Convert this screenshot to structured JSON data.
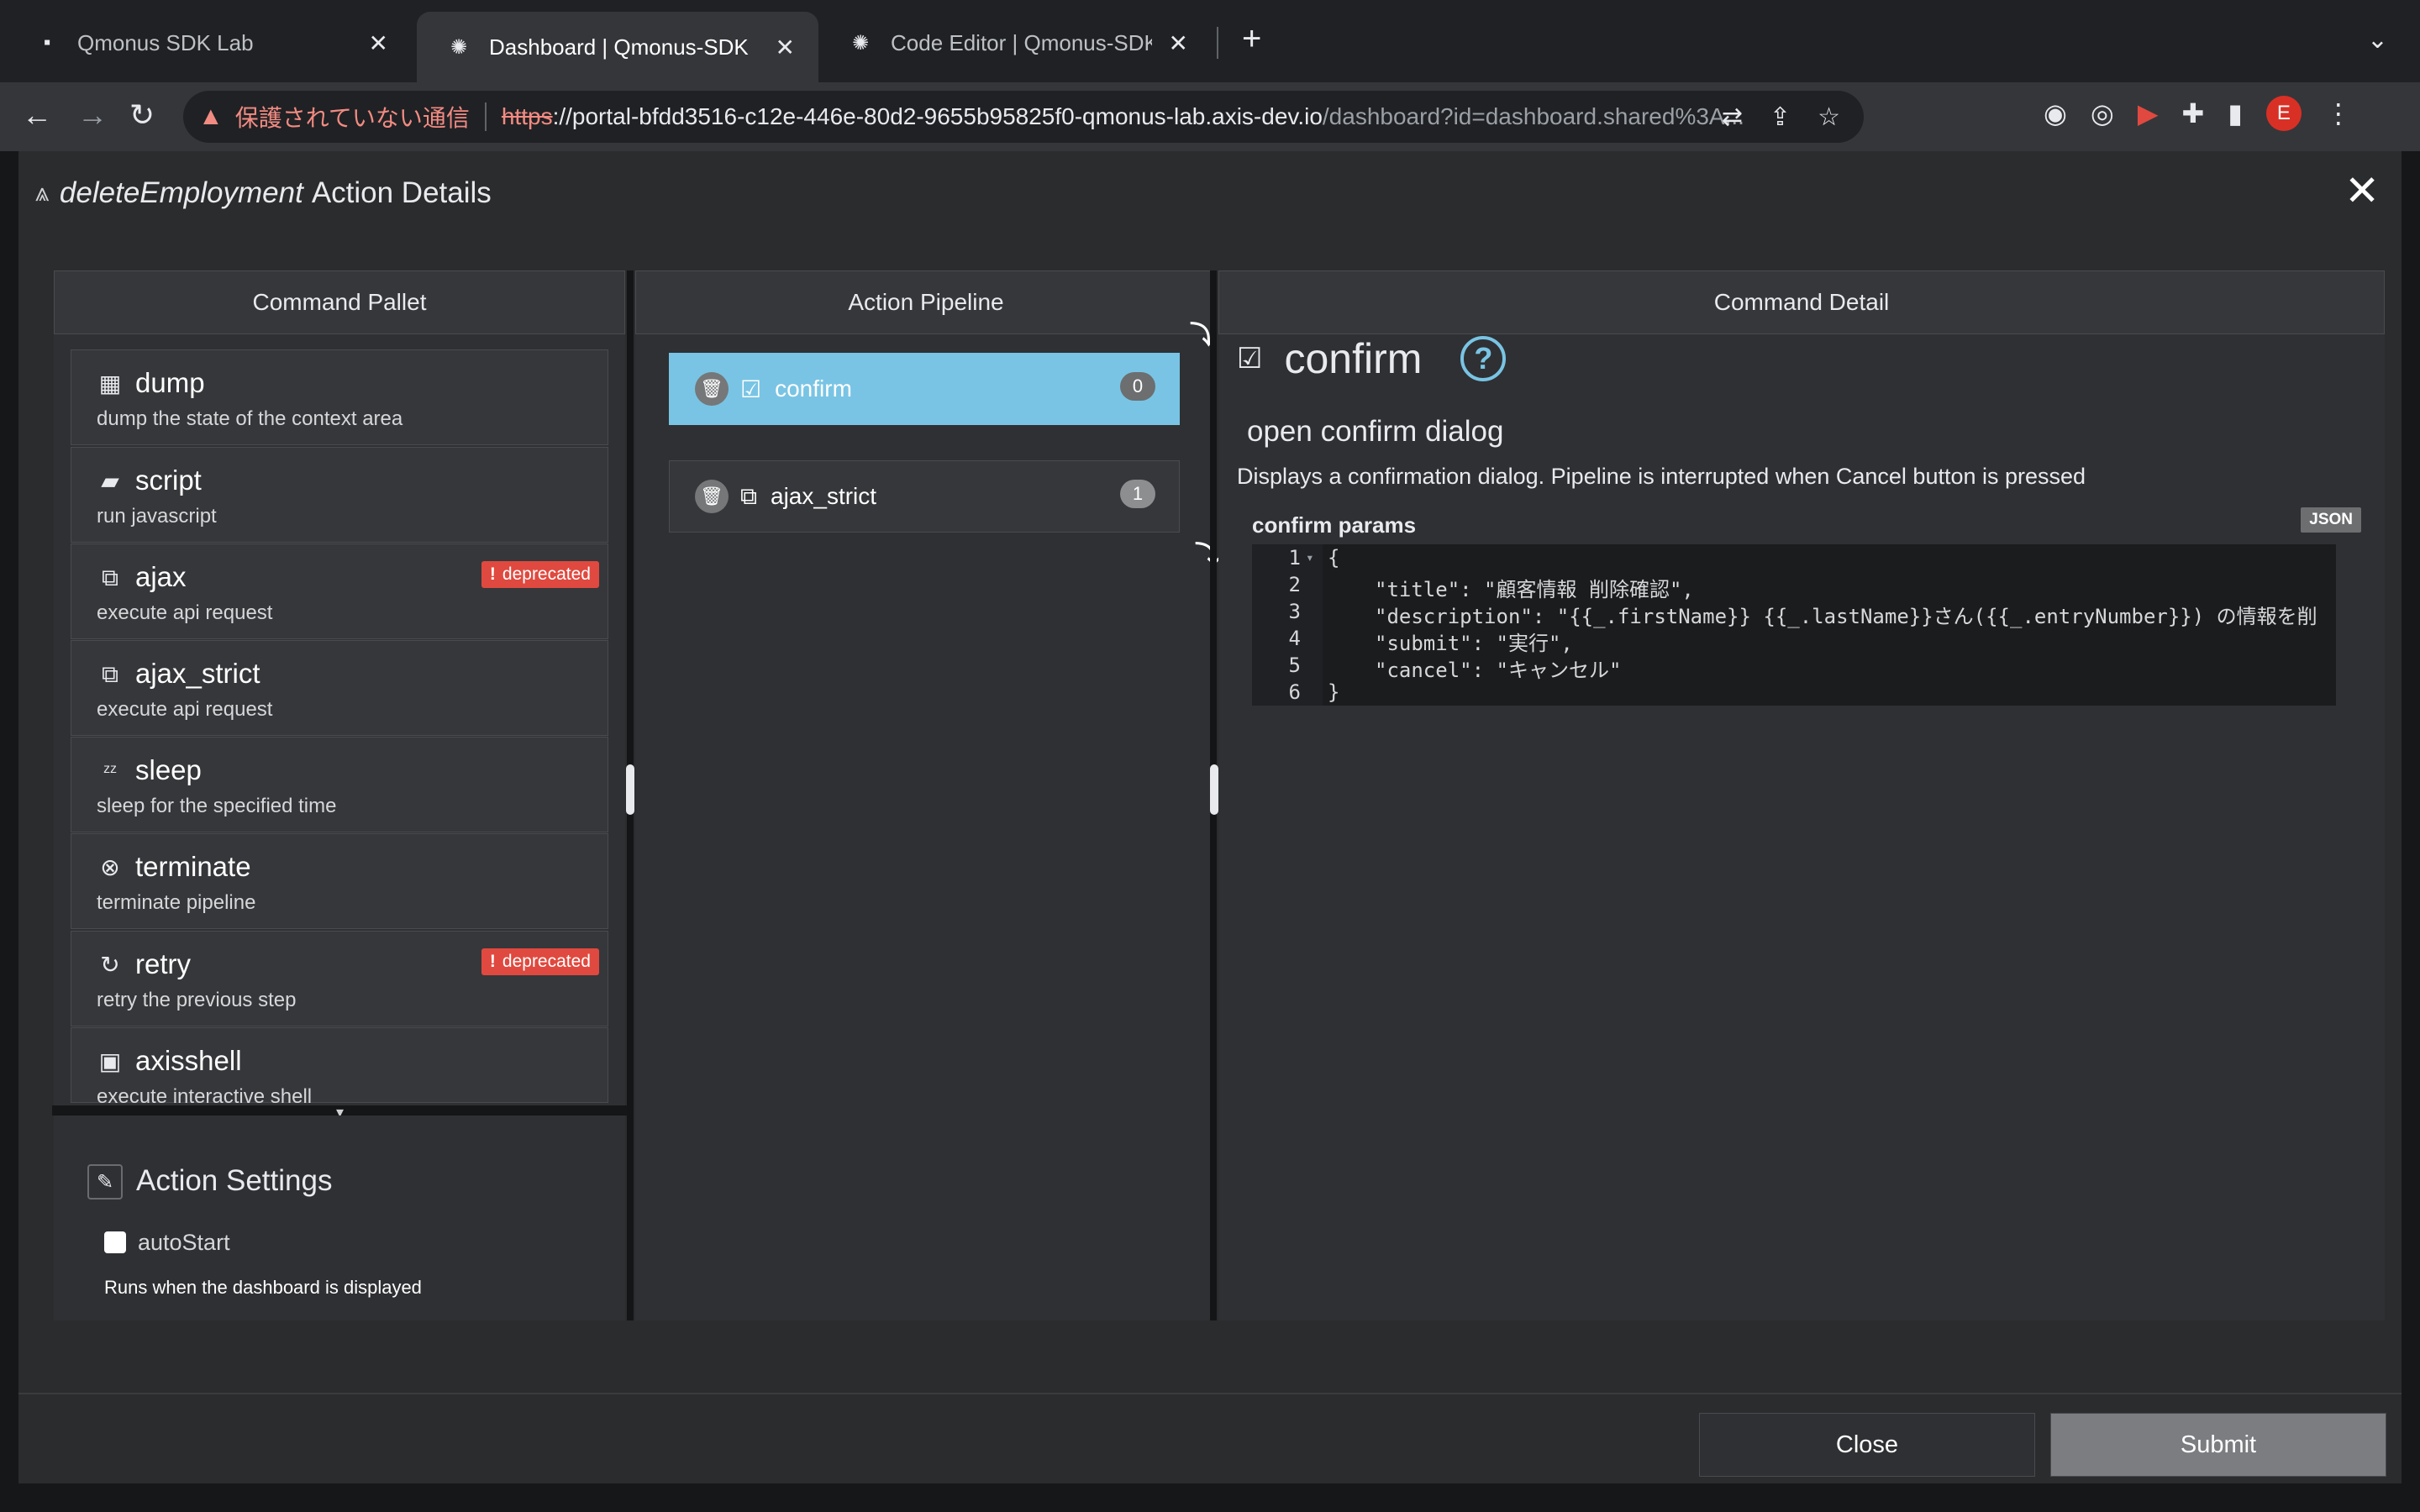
{
  "browser": {
    "tabs": [
      {
        "title": "Qmonus SDK Lab",
        "active": false
      },
      {
        "title": "Dashboard | Qmonus-SDK",
        "active": true
      },
      {
        "title": "Code Editor | Qmonus-SDK",
        "active": false
      }
    ],
    "address": {
      "security_text": "保護されていない通信",
      "scheme": "https",
      "host": "://portal-bfdd3516-c12e-446e-80d2-9655b95825f0-qmonus-lab.axis-dev.io",
      "path": "/dashboard?id=dashboard.shared%3A..."
    },
    "profile_initial": "E"
  },
  "modal": {
    "action_name": "deleteEmployment",
    "title_suffix": "Action Details",
    "columns": {
      "pallet": "Command Pallet",
      "pipeline": "Action Pipeline",
      "detail": "Command Detail"
    },
    "commands": [
      {
        "name": "dump",
        "desc": "dump the state of the context area",
        "icon": "qr-icon",
        "deprecated": false
      },
      {
        "name": "script",
        "desc": "run javascript",
        "icon": "script-icon",
        "deprecated": false
      },
      {
        "name": "ajax",
        "desc": "execute api request",
        "icon": "link-icon",
        "deprecated": true
      },
      {
        "name": "ajax_strict",
        "desc": "execute api request",
        "icon": "link-icon",
        "deprecated": false
      },
      {
        "name": "sleep",
        "desc": "sleep for the specified time",
        "icon": "sleep-icon",
        "deprecated": false
      },
      {
        "name": "terminate",
        "desc": "terminate pipeline",
        "icon": "x-circle-icon",
        "deprecated": false
      },
      {
        "name": "retry",
        "desc": "retry the previous step",
        "icon": "retry-icon",
        "deprecated": true
      },
      {
        "name": "axisshell",
        "desc": "execute interactive shell",
        "icon": "terminal-icon",
        "deprecated": false
      }
    ],
    "deprecated_label": "deprecated",
    "settings": {
      "title": "Action Settings",
      "autostart_label": "autoStart",
      "autostart_checked": false,
      "note": "Runs when the dashboard is displayed"
    },
    "pipeline": [
      {
        "name": "confirm",
        "index": "0",
        "active": true
      },
      {
        "name": "ajax_strict",
        "index": "1",
        "active": false
      }
    ],
    "detail": {
      "command": "confirm",
      "subtitle": "open confirm dialog",
      "description": "Displays a confirmation dialog. Pipeline is interrupted when Cancel button is pressed",
      "params_label": "confirm params",
      "json_badge": "JSON",
      "code_lines": [
        {
          "n": "1",
          "text": "{"
        },
        {
          "n": "2",
          "text": "\"title\": \"顧客情報 削除確認\","
        },
        {
          "n": "3",
          "text": "\"description\": \"{{_.firstName}} {{_.lastName}}さん({{_.entryNumber}}) の情報を削"
        },
        {
          "n": "4",
          "text": "\"submit\": \"実行\","
        },
        {
          "n": "5",
          "text": "\"cancel\": \"キャンセル\""
        },
        {
          "n": "6",
          "text": "}"
        }
      ]
    },
    "buttons": {
      "close": "Close",
      "submit": "Submit"
    }
  },
  "colors": {
    "accent": "#79c4e4",
    "deprecated": "#e0493f"
  }
}
